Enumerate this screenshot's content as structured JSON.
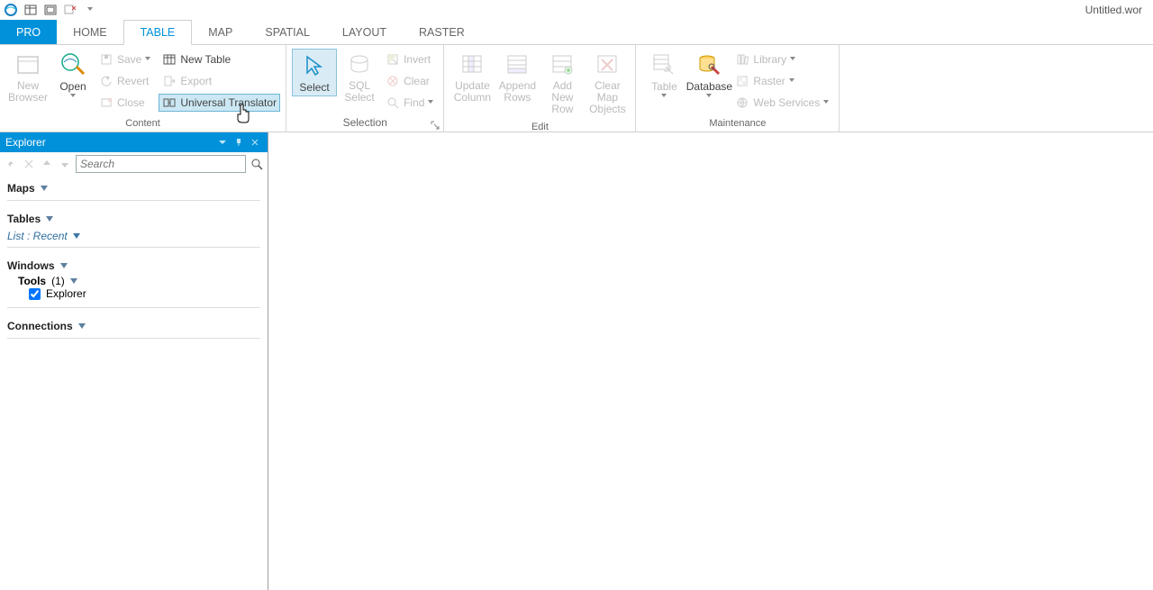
{
  "title": "Untitled.wor",
  "tabs": {
    "pro": "PRO",
    "home": "HOME",
    "table": "TABLE",
    "map": "MAP",
    "spatial": "SPATIAL",
    "layout": "LAYOUT",
    "raster": "RASTER"
  },
  "ribbon": {
    "content": {
      "label": "Content",
      "new_browser": "New Browser",
      "open": "Open",
      "save": "Save",
      "revert": "Revert",
      "close": "Close",
      "new_table": "New Table",
      "export": "Export",
      "universal_translator": "Universal Translator"
    },
    "selection": {
      "label": "Selection",
      "select": "Select",
      "sql_select": "SQL Select",
      "invert": "Invert",
      "clear": "Clear",
      "find": "Find"
    },
    "edit": {
      "label": "Edit",
      "update_column": "Update Column",
      "append_rows": "Append Rows",
      "add_new_row": "Add New Row",
      "clear_map_objects": "Clear Map Objects"
    },
    "maintenance": {
      "label": "Maintenance",
      "table": "Table",
      "database": "Database",
      "library": "Library",
      "raster": "Raster",
      "web_services": "Web Services"
    }
  },
  "explorer": {
    "title": "Explorer",
    "search_placeholder": "Search",
    "maps": "Maps",
    "tables": "Tables",
    "list_recent": "List : Recent",
    "windows": "Windows",
    "tools": "Tools",
    "tools_count": "(1)",
    "explorer_item": "Explorer",
    "connections": "Connections"
  }
}
